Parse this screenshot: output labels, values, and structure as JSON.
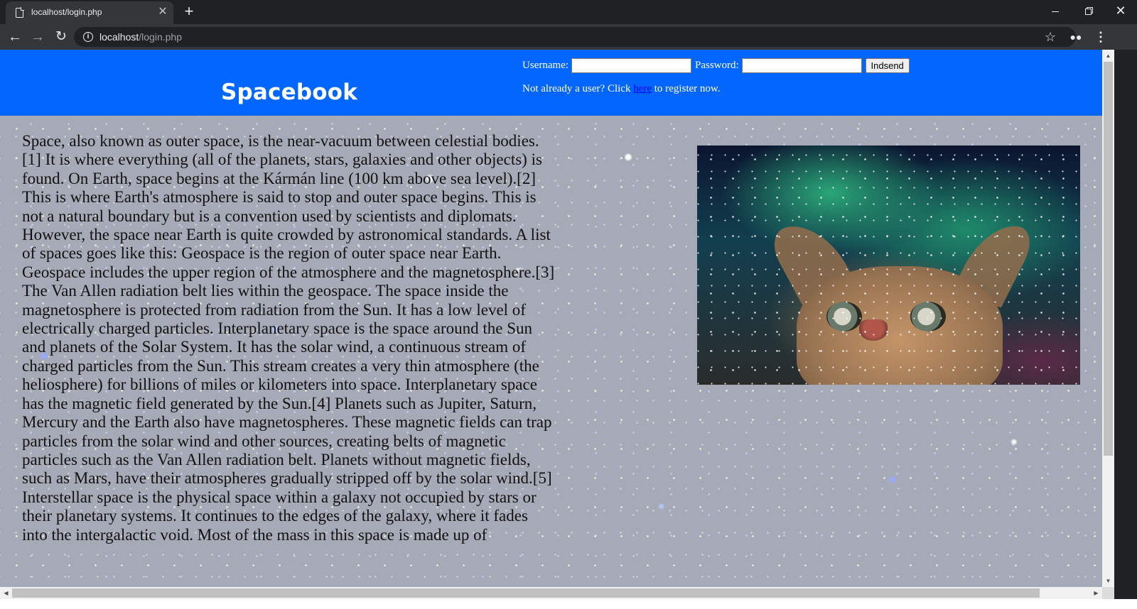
{
  "browser": {
    "tab_title": "localhost/login.php",
    "tab_close": "✕",
    "new_tab": "+",
    "url_host": "localhost",
    "url_path": "/login.php",
    "window_close": "✕"
  },
  "header": {
    "site_title": "Spacebook",
    "username_label": "Username:",
    "password_label": "Password:",
    "username_value": "",
    "password_value": "",
    "submit_label": "Indsend",
    "register_prefix": "Not already a user? Click",
    "register_link": "here",
    "register_suffix": "to register now."
  },
  "article": {
    "text": "Space, also known as outer space, is the near-vacuum between celestial bodies.[1] It is where everything (all of the planets, stars, galaxies and other objects) is found. On Earth, space begins at the Kármán line (100 km above sea level).[2] This is where Earth's atmosphere is said to stop and outer space begins. This is not a natural boundary but is a convention used by scientists and diplomats. However, the space near Earth is quite crowded by astronomical standards. A list of spaces goes like this: Geospace is the region of outer space near Earth. Geospace includes the upper region of the atmosphere and the magnetosphere.[3] The Van Allen radiation belt lies within the geospace. The space inside the magnetosphere is protected from radiation from the Sun. It has a low level of electrically charged particles. Interplanetary space is the space around the Sun and planets of the Solar System. It has the solar wind, a continuous stream of charged particles from the Sun. This stream creates a very thin atmosphere (the heliosphere) for billions of miles or kilometers into space. Interplanetary space has the magnetic field generated by the Sun.[4] Planets such as Jupiter, Saturn, Mercury and the Earth also have magnetospheres. These magnetic fields can trap particles from the solar wind and other sources, creating belts of magnetic particles such as the Van Allen radiation belt. Planets without magnetic fields, such as Mars, have their atmospheres gradually stripped off by the solar wind.[5] Interstellar space is the physical space within a galaxy not occupied by stars or their planetary systems. It continues to the edges of the galaxy, where it fades into the intergalactic void. Most of the mass in this space is made up of"
  },
  "colors": {
    "header_bg": "#0066ff",
    "link": "#0000ee",
    "browser_frame": "#202124",
    "toolbar": "#35363a"
  },
  "icons": {
    "tab": "document-icon",
    "back": "arrow-left-icon",
    "forward": "arrow-right-icon",
    "reload": "reload-icon",
    "site_info": "info-icon",
    "bookmark": "star-icon",
    "incognito": "incognito-icon",
    "menu": "kebab-menu-icon"
  }
}
